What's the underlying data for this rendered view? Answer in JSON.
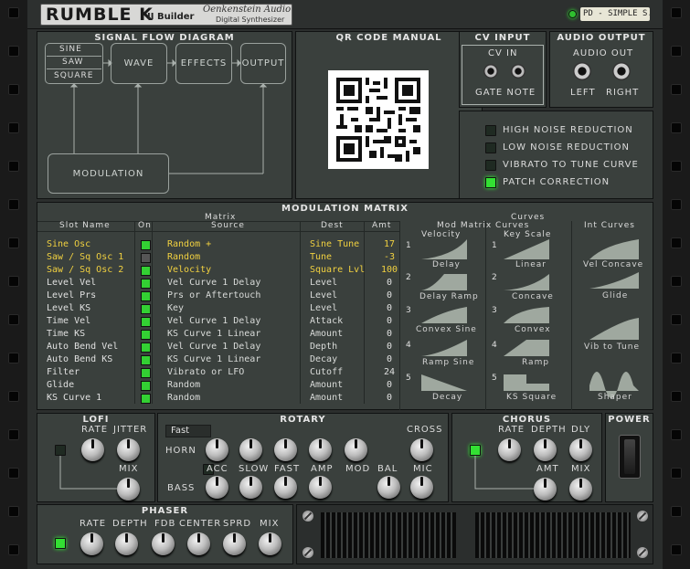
{
  "header": {
    "product": "RUMBLE K",
    "version": "II",
    "builder": "Builder",
    "brand": "Oenkenstein Audio",
    "subtitle": "Digital Synthesizer",
    "patch_name": "PD - SIMPLE S..."
  },
  "signal_flow": {
    "title": "SIGNAL FLOW DIAGRAM",
    "osc": [
      "SINE",
      "SAW",
      "SQUARE"
    ],
    "wave": "WAVE",
    "effects": "EFFECTS",
    "output": "OUTPUT",
    "modulation": "MODULATION"
  },
  "qr": {
    "title": "QR CODE MANUAL"
  },
  "cv_input": {
    "title": "CV INPUT",
    "cv_in": "CV IN",
    "gate_note": "GATE NOTE"
  },
  "audio_output": {
    "title": "AUDIO OUTPUT",
    "audio_out": "AUDIO OUT",
    "left": "LEFT",
    "right": "RIGHT"
  },
  "options": [
    {
      "label": "HIGH NOISE REDUCTION",
      "on": false
    },
    {
      "label": "LOW NOISE REDUCTION",
      "on": false
    },
    {
      "label": "VIBRATO TO TUNE CURVE",
      "on": false
    },
    {
      "label": "PATCH CORRECTION",
      "on": true
    }
  ],
  "matrix": {
    "title": "MODULATION MATRIX",
    "section": "Matrix",
    "cols": {
      "slot": "Slot Name",
      "on": "On",
      "source": "Source",
      "dest": "Dest",
      "amt": "Amt"
    },
    "rows": [
      {
        "name": "Sine Osc",
        "on": true,
        "source": "Random +",
        "dest": "Sine Tune",
        "amt": "17",
        "hl": true
      },
      {
        "name": "Saw / Sq Osc 1",
        "on": false,
        "source": "Random",
        "dest": "Tune",
        "amt": "-3",
        "hl": true
      },
      {
        "name": "Saw / Sq Osc 2",
        "on": true,
        "source": "Velocity",
        "dest": "Square Lvl",
        "amt": "100",
        "hl": true
      },
      {
        "name": "Level Vel",
        "on": true,
        "source": "Vel Curve 1 Delay",
        "dest": "Level",
        "amt": "0",
        "hl": false
      },
      {
        "name": "Level Prs",
        "on": true,
        "source": "Prs or Aftertouch",
        "dest": "Level",
        "amt": "0",
        "hl": false
      },
      {
        "name": "Level KS",
        "on": true,
        "source": "Key",
        "dest": "Level",
        "amt": "0",
        "hl": false
      },
      {
        "name": "Time Vel",
        "on": true,
        "source": "Vel Curve 1 Delay",
        "dest": "Attack",
        "amt": "0",
        "hl": false
      },
      {
        "name": "Time KS",
        "on": true,
        "source": "KS Curve 1 Linear",
        "dest": "Amount",
        "amt": "0",
        "hl": false
      },
      {
        "name": "Auto Bend Vel",
        "on": true,
        "source": "Vel Curve 1 Delay",
        "dest": "Depth",
        "amt": "0",
        "hl": false
      },
      {
        "name": "Auto Bend KS",
        "on": true,
        "source": "KS Curve 1 Linear",
        "dest": "Decay",
        "amt": "0",
        "hl": false
      },
      {
        "name": "Filter",
        "on": true,
        "source": "Vibrato or LFO",
        "dest": "Cutoff",
        "amt": "24",
        "hl": false
      },
      {
        "name": "Glide",
        "on": true,
        "source": "Random",
        "dest": "Amount",
        "amt": "0",
        "hl": false
      },
      {
        "name": "KS Curve 1",
        "on": true,
        "source": "Random",
        "dest": "Amount",
        "amt": "0",
        "hl": false
      }
    ]
  },
  "curves": {
    "title": "Curves",
    "mod_title": "Mod Matrix Curves",
    "velocity": "Velocity",
    "key_scale": "Key Scale",
    "int_title": "Int Curves",
    "vel_curves": [
      "Delay",
      "Delay Ramp",
      "Convex Sine",
      "Ramp Sine",
      "Decay"
    ],
    "ks_curves": [
      "Linear",
      "Concave",
      "Convex",
      "Ramp",
      "KS Square"
    ],
    "int_curves": [
      "Vel Concave",
      "Glide",
      "Vib to Tune",
      "Shaper"
    ],
    "numbers": [
      "1",
      "2",
      "3",
      "4",
      "5"
    ]
  },
  "lofi": {
    "title": "LOFI",
    "rate": "RATE",
    "jitter": "JITTER",
    "mix": "MIX"
  },
  "rotary": {
    "title": "ROTARY",
    "speed": "Fast",
    "horn": "HORN",
    "bass": "BASS",
    "acc": "ACC",
    "slow": "SLOW",
    "fast": "FAST",
    "amp": "AMP",
    "mod": "MOD",
    "bal": "BAL",
    "cross": "CROSS",
    "mic": "MIC"
  },
  "chorus": {
    "title": "CHORUS",
    "rate": "RATE",
    "depth": "DEPTH",
    "dly": "DLY",
    "amt": "AMT",
    "mix": "MIX"
  },
  "power": {
    "title": "POWER"
  },
  "phaser": {
    "title": "PHASER",
    "rate": "RATE",
    "depth": "DEPTH",
    "fdb": "FDB",
    "center": "CENTER",
    "sprd": "SPRD",
    "mix": "MIX"
  }
}
